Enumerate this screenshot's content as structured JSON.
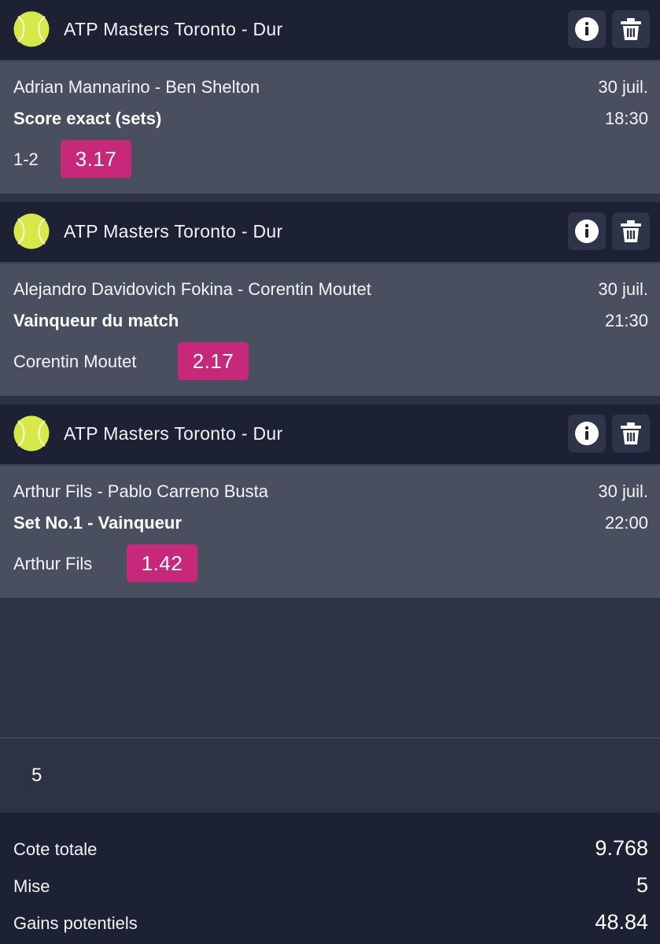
{
  "colors": {
    "odds_badge": "#c8287a",
    "header_bg": "#1c2133",
    "body_bg": "#4a4f5f",
    "ball": "#d6e84a"
  },
  "bets": [
    {
      "league": "ATP Masters Toronto - Dur",
      "sport_icon": "tennis-ball-icon",
      "match": "Adrian Mannarino - Ben Shelton",
      "date": "30 juil.",
      "market": "Score exact (sets)",
      "time": "18:30",
      "selection": "1-2",
      "odds": "3.17"
    },
    {
      "league": "ATP Masters Toronto - Dur",
      "sport_icon": "tennis-ball-icon",
      "match": "Alejandro Davidovich Fokina - Corentin Moutet",
      "date": "30 juil.",
      "market": "Vainqueur du match",
      "time": "21:30",
      "selection": "Corentin Moutet",
      "odds": "2.17"
    },
    {
      "league": "ATP Masters Toronto - Dur",
      "sport_icon": "tennis-ball-icon",
      "match": "Arthur Fils - Pablo Carreno Busta",
      "date": "30 juil.",
      "market": "Set No.1 - Vainqueur",
      "time": "22:00",
      "selection": "Arthur Fils",
      "odds": "1.42"
    }
  ],
  "stake_input": {
    "value": "5"
  },
  "summary": {
    "total_odds_label": "Cote totale",
    "total_odds_value": "9.768",
    "stake_label": "Mise",
    "stake_value": "5",
    "potential_gains_label": "Gains potentiels",
    "potential_gains_value": "48.84"
  }
}
